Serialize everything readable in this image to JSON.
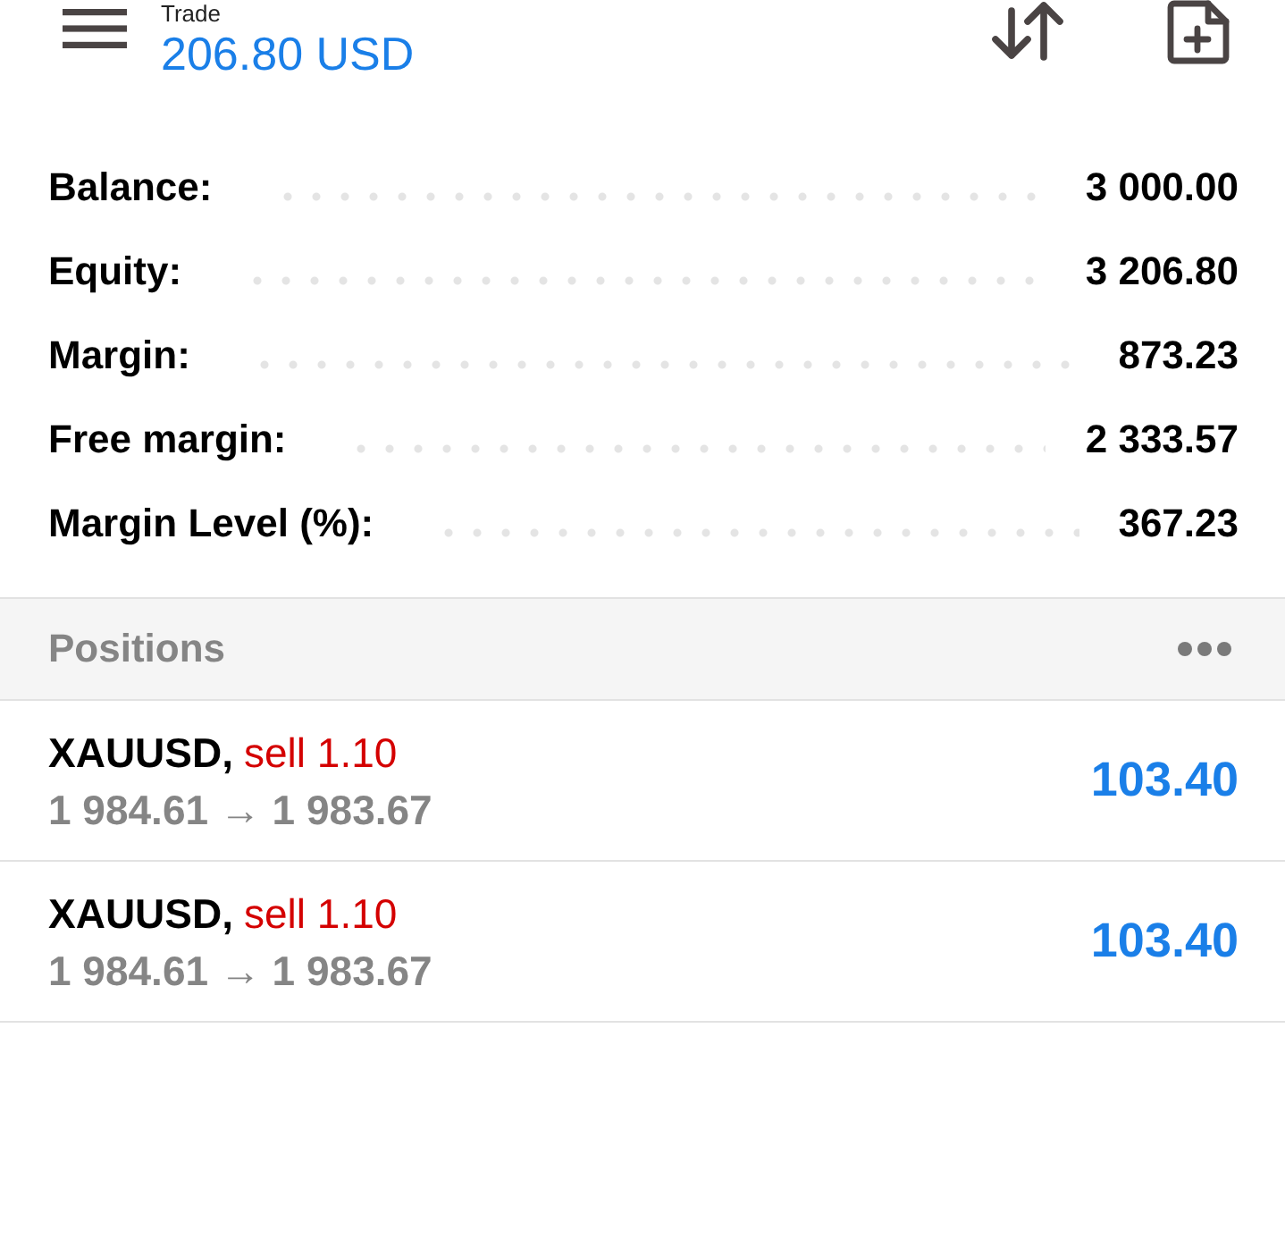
{
  "header": {
    "title": "Trade",
    "balance": "206.80 USD"
  },
  "summary": [
    {
      "label": "Balance:",
      "value": "3 000.00"
    },
    {
      "label": "Equity:",
      "value": "3 206.80"
    },
    {
      "label": "Margin:",
      "value": "873.23"
    },
    {
      "label": "Free margin:",
      "value": "2 333.57"
    },
    {
      "label": "Margin Level (%):",
      "value": "367.23"
    }
  ],
  "positions": {
    "title": "Positions",
    "items": [
      {
        "symbol": "XAUUSD,",
        "type": "sell",
        "volume": "1.10",
        "prices": "1 984.61 → 1 983.67",
        "profit": "103.40"
      },
      {
        "symbol": "XAUUSD,",
        "type": "sell",
        "volume": "1.10",
        "prices": "1 984.61 → 1 983.67",
        "profit": "103.40"
      }
    ]
  }
}
